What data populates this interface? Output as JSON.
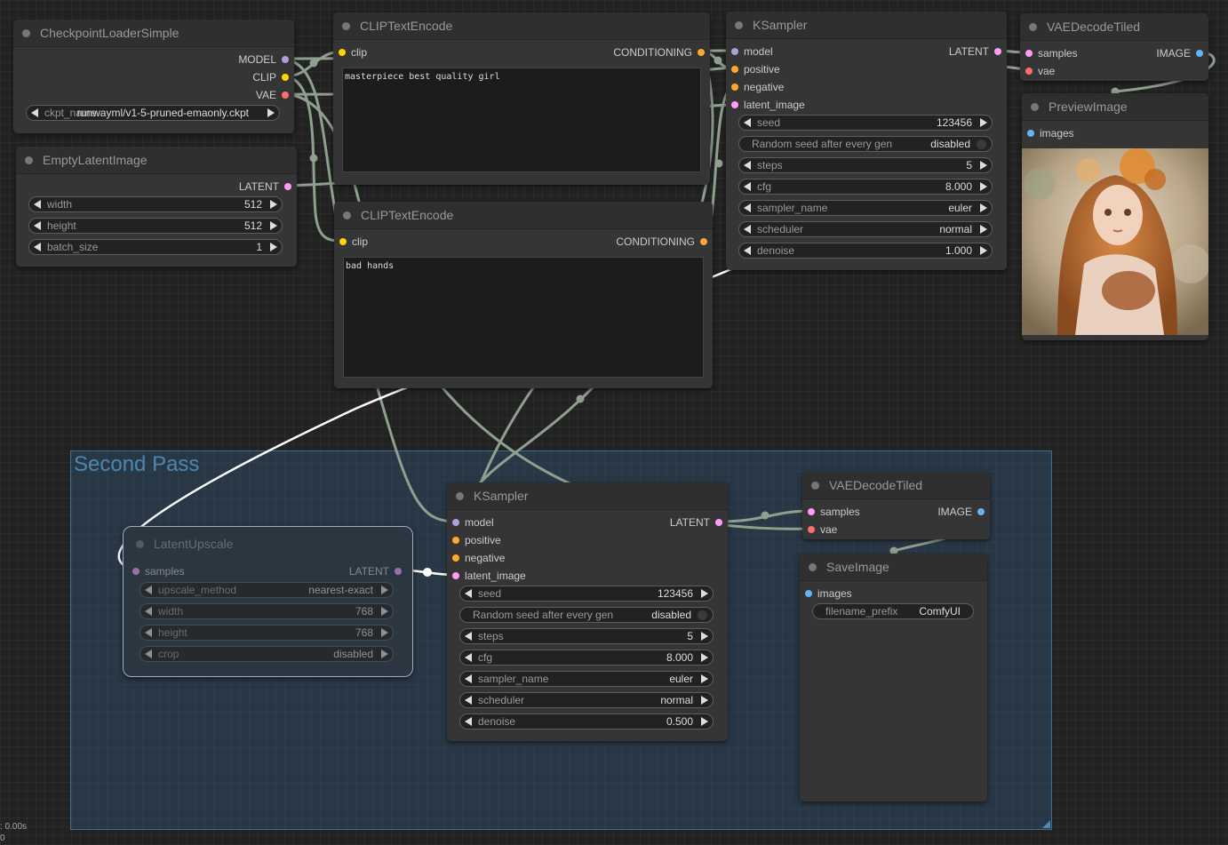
{
  "group": {
    "title": "Second Pass"
  },
  "status": {
    "time": ": 0.00s",
    "count": "0"
  },
  "colors": {
    "model": "#b39ddb",
    "clip": "#ffd500",
    "vae": "#ff6e6e",
    "conditioning": "#ffa931",
    "latent": "#ff9cf9",
    "image": "#64b5f6",
    "link": "#8fa08f",
    "group": "#4f86ad"
  },
  "checkpoint": {
    "title": "CheckpointLoaderSimple",
    "outputs": [
      "MODEL",
      "CLIP",
      "VAE"
    ],
    "ckpt_label": "ckpt_name",
    "ckpt_value": "runwayml/v1-5-pruned-emaonly.ckpt"
  },
  "empty_latent": {
    "title": "EmptyLatentImage",
    "output": "LATENT",
    "width_label": "width",
    "width_value": "512",
    "height_label": "height",
    "height_value": "512",
    "batch_label": "batch_size",
    "batch_value": "1"
  },
  "clip_pos": {
    "title": "CLIPTextEncode",
    "input": "clip",
    "output": "CONDITIONING",
    "text": "masterpiece best quality girl"
  },
  "clip_neg": {
    "title": "CLIPTextEncode",
    "input": "clip",
    "output": "CONDITIONING",
    "text": "bad hands"
  },
  "ksampler1": {
    "title": "KSampler",
    "inputs": [
      "model",
      "positive",
      "negative",
      "latent_image"
    ],
    "output": "LATENT",
    "widgets": [
      {
        "label": "seed",
        "value": "123456"
      },
      {
        "label": "Random seed after every gen",
        "value": "disabled"
      },
      {
        "label": "steps",
        "value": "5"
      },
      {
        "label": "cfg",
        "value": "8.000"
      },
      {
        "label": "sampler_name",
        "value": "euler"
      },
      {
        "label": "scheduler",
        "value": "normal"
      },
      {
        "label": "denoise",
        "value": "1.000"
      }
    ]
  },
  "vae_decode1": {
    "title": "VAEDecodeTiled",
    "inputs": [
      "samples",
      "vae"
    ],
    "output": "IMAGE"
  },
  "preview": {
    "title": "PreviewImage",
    "input": "images"
  },
  "latent_upscale": {
    "title": "LatentUpscale",
    "input": "samples",
    "output": "LATENT",
    "widgets": [
      {
        "label": "upscale_method",
        "value": "nearest-exact"
      },
      {
        "label": "width",
        "value": "768"
      },
      {
        "label": "height",
        "value": "768"
      },
      {
        "label": "crop",
        "value": "disabled"
      }
    ]
  },
  "ksampler2": {
    "title": "KSampler",
    "inputs": [
      "model",
      "positive",
      "negative",
      "latent_image"
    ],
    "output": "LATENT",
    "widgets": [
      {
        "label": "seed",
        "value": "123456"
      },
      {
        "label": "Random seed after every gen",
        "value": "disabled"
      },
      {
        "label": "steps",
        "value": "5"
      },
      {
        "label": "cfg",
        "value": "8.000"
      },
      {
        "label": "sampler_name",
        "value": "euler"
      },
      {
        "label": "scheduler",
        "value": "normal"
      },
      {
        "label": "denoise",
        "value": "0.500"
      }
    ]
  },
  "vae_decode2": {
    "title": "VAEDecodeTiled",
    "inputs": [
      "samples",
      "vae"
    ],
    "output": "IMAGE"
  },
  "save_image": {
    "title": "SaveImage",
    "input": "images",
    "prefix_label": "filename_prefix",
    "prefix_value": "ComfyUI"
  }
}
